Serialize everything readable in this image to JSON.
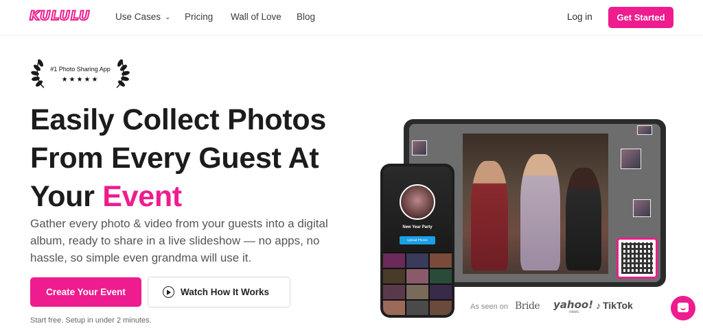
{
  "brand": {
    "logo_text": "KULULU",
    "accent_color": "#ee1c8e"
  },
  "nav": {
    "items": [
      {
        "label": "Use Cases",
        "has_dropdown": true
      },
      {
        "label": "Pricing"
      },
      {
        "label": "Wall of Love"
      },
      {
        "label": "Blog"
      }
    ],
    "login": "Log in",
    "cta": "Get Started"
  },
  "badge": {
    "text": "#1 Photo Sharing App",
    "stars": "★★★★★"
  },
  "hero": {
    "title_line1": "Easily Collect Photos",
    "title_line2": "From Every Guest At",
    "title_line3_prefix": "Your ",
    "title_line3_accent": "Event",
    "subtitle": "Gather every photo & video from your guests into a digital album, ready to share in a live slideshow — no apps, no hassle, so simple even grandma will use it.",
    "primary_button": "Create Your Event",
    "secondary_button": "Watch How It Works",
    "note": "Start free. Setup in under 2 minutes."
  },
  "phone": {
    "event_name": "New Year Party",
    "upload_button": "Upload Photos"
  },
  "press": {
    "label": "As seen on",
    "logos": [
      "Bride",
      "yahoo!",
      "news",
      "TikTok"
    ]
  }
}
